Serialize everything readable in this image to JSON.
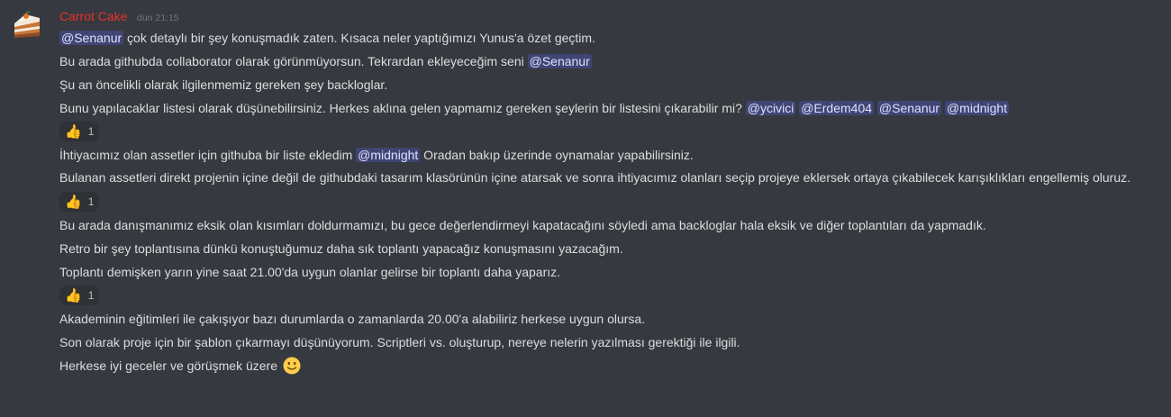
{
  "message": {
    "username": "Carrot Cake",
    "timestamp": "dün 21:15",
    "colors": {
      "username": "#e8302a",
      "mention_bg": "#5865f2",
      "background": "#36393f"
    },
    "avatar_icon": "cake-slice-icon",
    "lines": [
      {
        "mention": "@Senanur",
        "text": " çok detaylı bir şey konuşmadık zaten. Kısaca neler yaptığımızı Yunus'a özet geçtim."
      },
      {
        "text": "Bu arada githubda collaborator olarak görünmüyorsun. Tekrardan ekleyeceğim seni ",
        "mention": "@Senanur"
      },
      {
        "text": "Şu an öncelikli olarak ilgilenmemiz gereken şey backloglar."
      },
      {
        "text": "Bunu yapılacaklar listesi olarak düşünebilirsiniz. Herkes aklına gelen yapmamız gereken şeylerin bir listesini çıkarabilir mi? ",
        "mentions": [
          "@ycivici",
          "@Erdem404",
          "@Senanur",
          "@midnight"
        ]
      },
      {
        "text_before": "İhtiyacımız olan assetler için githuba bir liste ekledim ",
        "mention": "@midnight",
        "text_after": " Oradan bakıp üzerinde oynamalar yapabilirsiniz."
      },
      {
        "text": "Bulanan assetleri direkt projenin içine değil de githubdaki tasarım klasörünün içine atarsak ve sonra ihtiyacımız olanları seçip projeye eklersek ortaya çıkabilecek karışıklıkları engellemiş oluruz."
      },
      {
        "text": "Bu arada danışmanımız eksik olan kısımları doldurmamızı, bu gece değerlendirmeyi kapatacağını söyledi ama backloglar hala eksik ve diğer toplantıları da yapmadık."
      },
      {
        "text": "Retro bir şey toplantısına dünkü konuştuğumuz daha sık toplantı yapacağız konuşmasını yazacağım."
      },
      {
        "text": "Toplantı demişken yarın yine saat 21.00'da uygun olanlar gelirse bir toplantı daha yaparız."
      },
      {
        "text": "Akademinin eğitimleri ile çakışıyor bazı durumlarda o zamanlarda 20.00'a alabiliriz herkese uygun olursa."
      },
      {
        "text": "Son olarak proje için bir şablon çıkarmayı düşünüyorum. Scriptleri vs. oluşturup, nereye nelerin yazılması gerektiği ile ilgili."
      },
      {
        "text": "Herkese iyi geceler ve görüşmek üzere",
        "emoji": "slightly-smiling-face-icon"
      }
    ],
    "reactions": [
      {
        "emoji": "👍",
        "icon": "thumbs-up-icon",
        "count": "1"
      },
      {
        "emoji": "👍",
        "icon": "thumbs-up-icon",
        "count": "1"
      },
      {
        "emoji": "👍",
        "icon": "thumbs-up-icon",
        "count": "1"
      }
    ]
  }
}
